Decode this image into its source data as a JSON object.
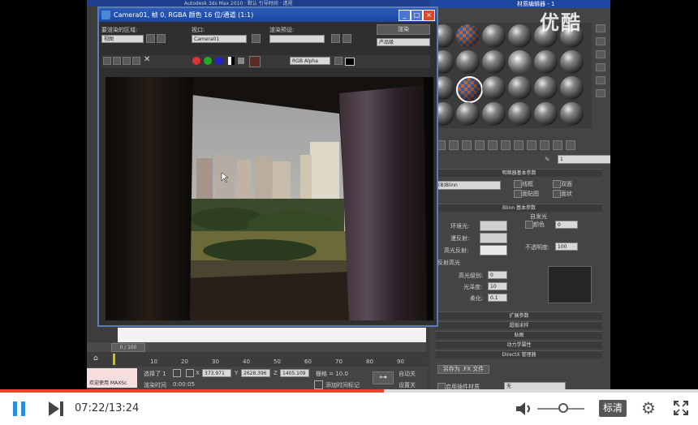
{
  "watermark": "优酷",
  "max_title": "Autodesk 3ds Max 2010 · 默认 引导时间 · 透视",
  "render_window": {
    "title": "Camera01, 帧 0, RGBA 颜色 16 位/通道 (1:1)",
    "area_label": "要渲染的区域:",
    "area_value": "视图",
    "viewport_label": "视口:",
    "viewport_value": "Camera01",
    "preset_label": "渲染预设:",
    "preset_value": "",
    "render_button": "渲染",
    "product_value": "产品级",
    "channel_value": "RGB Alpha"
  },
  "material_editor": {
    "title": "材质编辑器 - 1",
    "material_name": "1",
    "material_type": "Standard",
    "shader_header": "明暗器基本参数",
    "shader_value": "(B)Blinn",
    "wire_label": "线框",
    "two_sided_label": "双面",
    "facemap_label": "面贴图",
    "faceted_label": "面状",
    "blinn_header": "Blinn 基本参数",
    "self_illum_label": "自发光",
    "color_label": "颜色",
    "color_value": "0",
    "ambient_label": "环境光:",
    "diffuse_label": "漫反射:",
    "specular_label": "高光反射:",
    "opacity_label": "不透明度:",
    "opacity_value": "100",
    "highlight_header": "反射高光",
    "spec_level_label": "高光级别:",
    "spec_level_value": "0",
    "gloss_label": "光泽度:",
    "gloss_value": "10",
    "soften_label": "柔化:",
    "soften_value": "0.1",
    "rollouts": [
      "扩展参数",
      "超级采样",
      "贴图",
      "动力学属性",
      "DirectX 管理器"
    ],
    "save_fx_button": "另存为 .FX 文件",
    "enable_plugin_label": "启用插件材质",
    "none_value": "无"
  },
  "timeline": {
    "frame_display": "0 / 100",
    "ticks": [
      "10",
      "20",
      "30",
      "40",
      "50",
      "60",
      "70",
      "80",
      "90"
    ]
  },
  "status": {
    "welcome": "欢迎使用 MAXSc",
    "selected": "选择了 1",
    "x_value": "373.971",
    "y_value": "2628.396",
    "z_value": "1405.109",
    "grid_label": "栅格 = 10.0",
    "render_time_label": "渲染时间",
    "render_time_value": "0:00:05",
    "add_time_tag": "添加时间标记",
    "auto_key": "自动关",
    "set_key": "设置关"
  },
  "player": {
    "current_time": "07:22",
    "total_time": "13:24",
    "quality_label": "标清",
    "progress": 0.55,
    "volume": 0.55,
    "accent": "#e8452e"
  }
}
